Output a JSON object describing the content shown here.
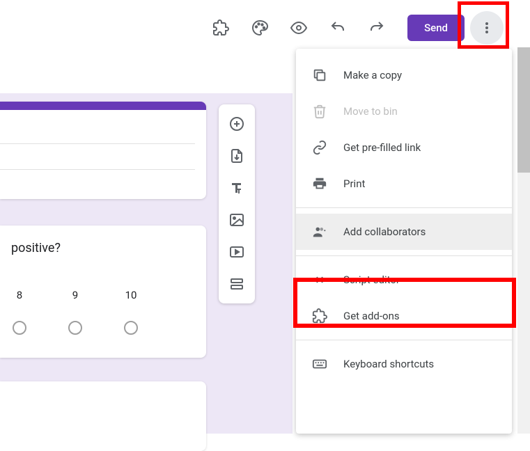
{
  "topbar": {
    "send": "Send"
  },
  "question": {
    "text": "positive?",
    "options": [
      "8",
      "9",
      "10"
    ]
  },
  "menu": {
    "copy": "Make a copy",
    "bin": "Move to bin",
    "prefilled": "Get pre-filled link",
    "print": "Print",
    "collab": "Add collaborators",
    "script": "Script editor",
    "addons": "Get add-ons",
    "shortcuts": "Keyboard shortcuts"
  }
}
